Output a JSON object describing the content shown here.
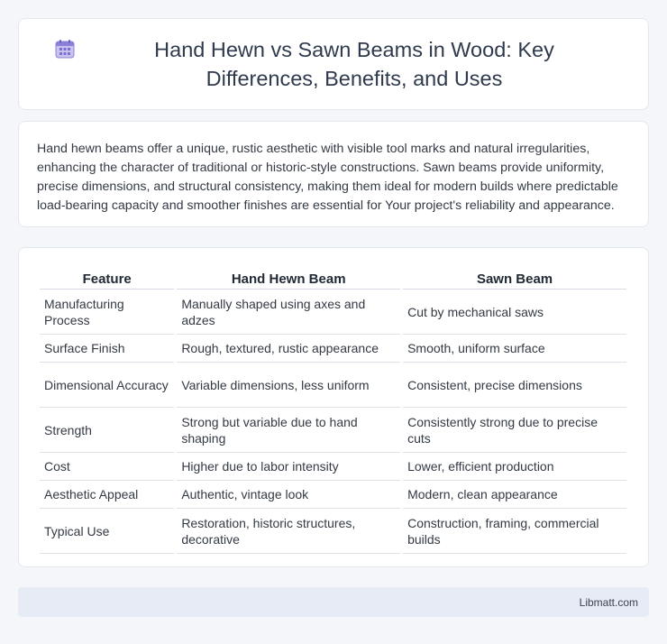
{
  "header": {
    "title": "Hand Hewn vs Sawn Beams in Wood: Key Differences, Benefits, and Uses",
    "icon": "calendar-grid-icon"
  },
  "summary": {
    "text": "Hand hewn beams offer a unique, rustic aesthetic with visible tool marks and natural irregularities, enhancing the character of traditional or historic-style constructions. Sawn beams provide uniformity, precise dimensions, and structural consistency, making them ideal for modern builds where predictable load-bearing capacity and smoother finishes are essential for Your project's reliability and appearance."
  },
  "table": {
    "headers": [
      "Feature",
      "Hand Hewn Beam",
      "Sawn Beam"
    ],
    "rows": [
      [
        "Manufacturing Process",
        "Manually shaped using axes and adzes",
        "Cut by mechanical saws"
      ],
      [
        "Surface Finish",
        "Rough, textured, rustic appearance",
        "Smooth, uniform surface"
      ],
      [
        "Dimensional Accuracy",
        "Variable dimensions, less uniform",
        "Consistent, precise dimensions"
      ],
      [
        "Strength",
        "Strong but variable due to hand shaping",
        "Consistently strong due to precise cuts"
      ],
      [
        "Cost",
        "Higher due to labor intensity",
        "Lower, efficient production"
      ],
      [
        "Aesthetic Appeal",
        "Authentic, vintage look",
        "Modern, clean appearance"
      ],
      [
        "Typical Use",
        "Restoration, historic structures, decorative",
        "Construction, framing, commercial builds"
      ]
    ]
  },
  "footer": {
    "brand": "Libmatt.com"
  },
  "colors": {
    "background": "#f4f6fa",
    "card": "#ffffff",
    "footer": "#e6ebf6",
    "icon_accent": "#7b6fd6"
  }
}
